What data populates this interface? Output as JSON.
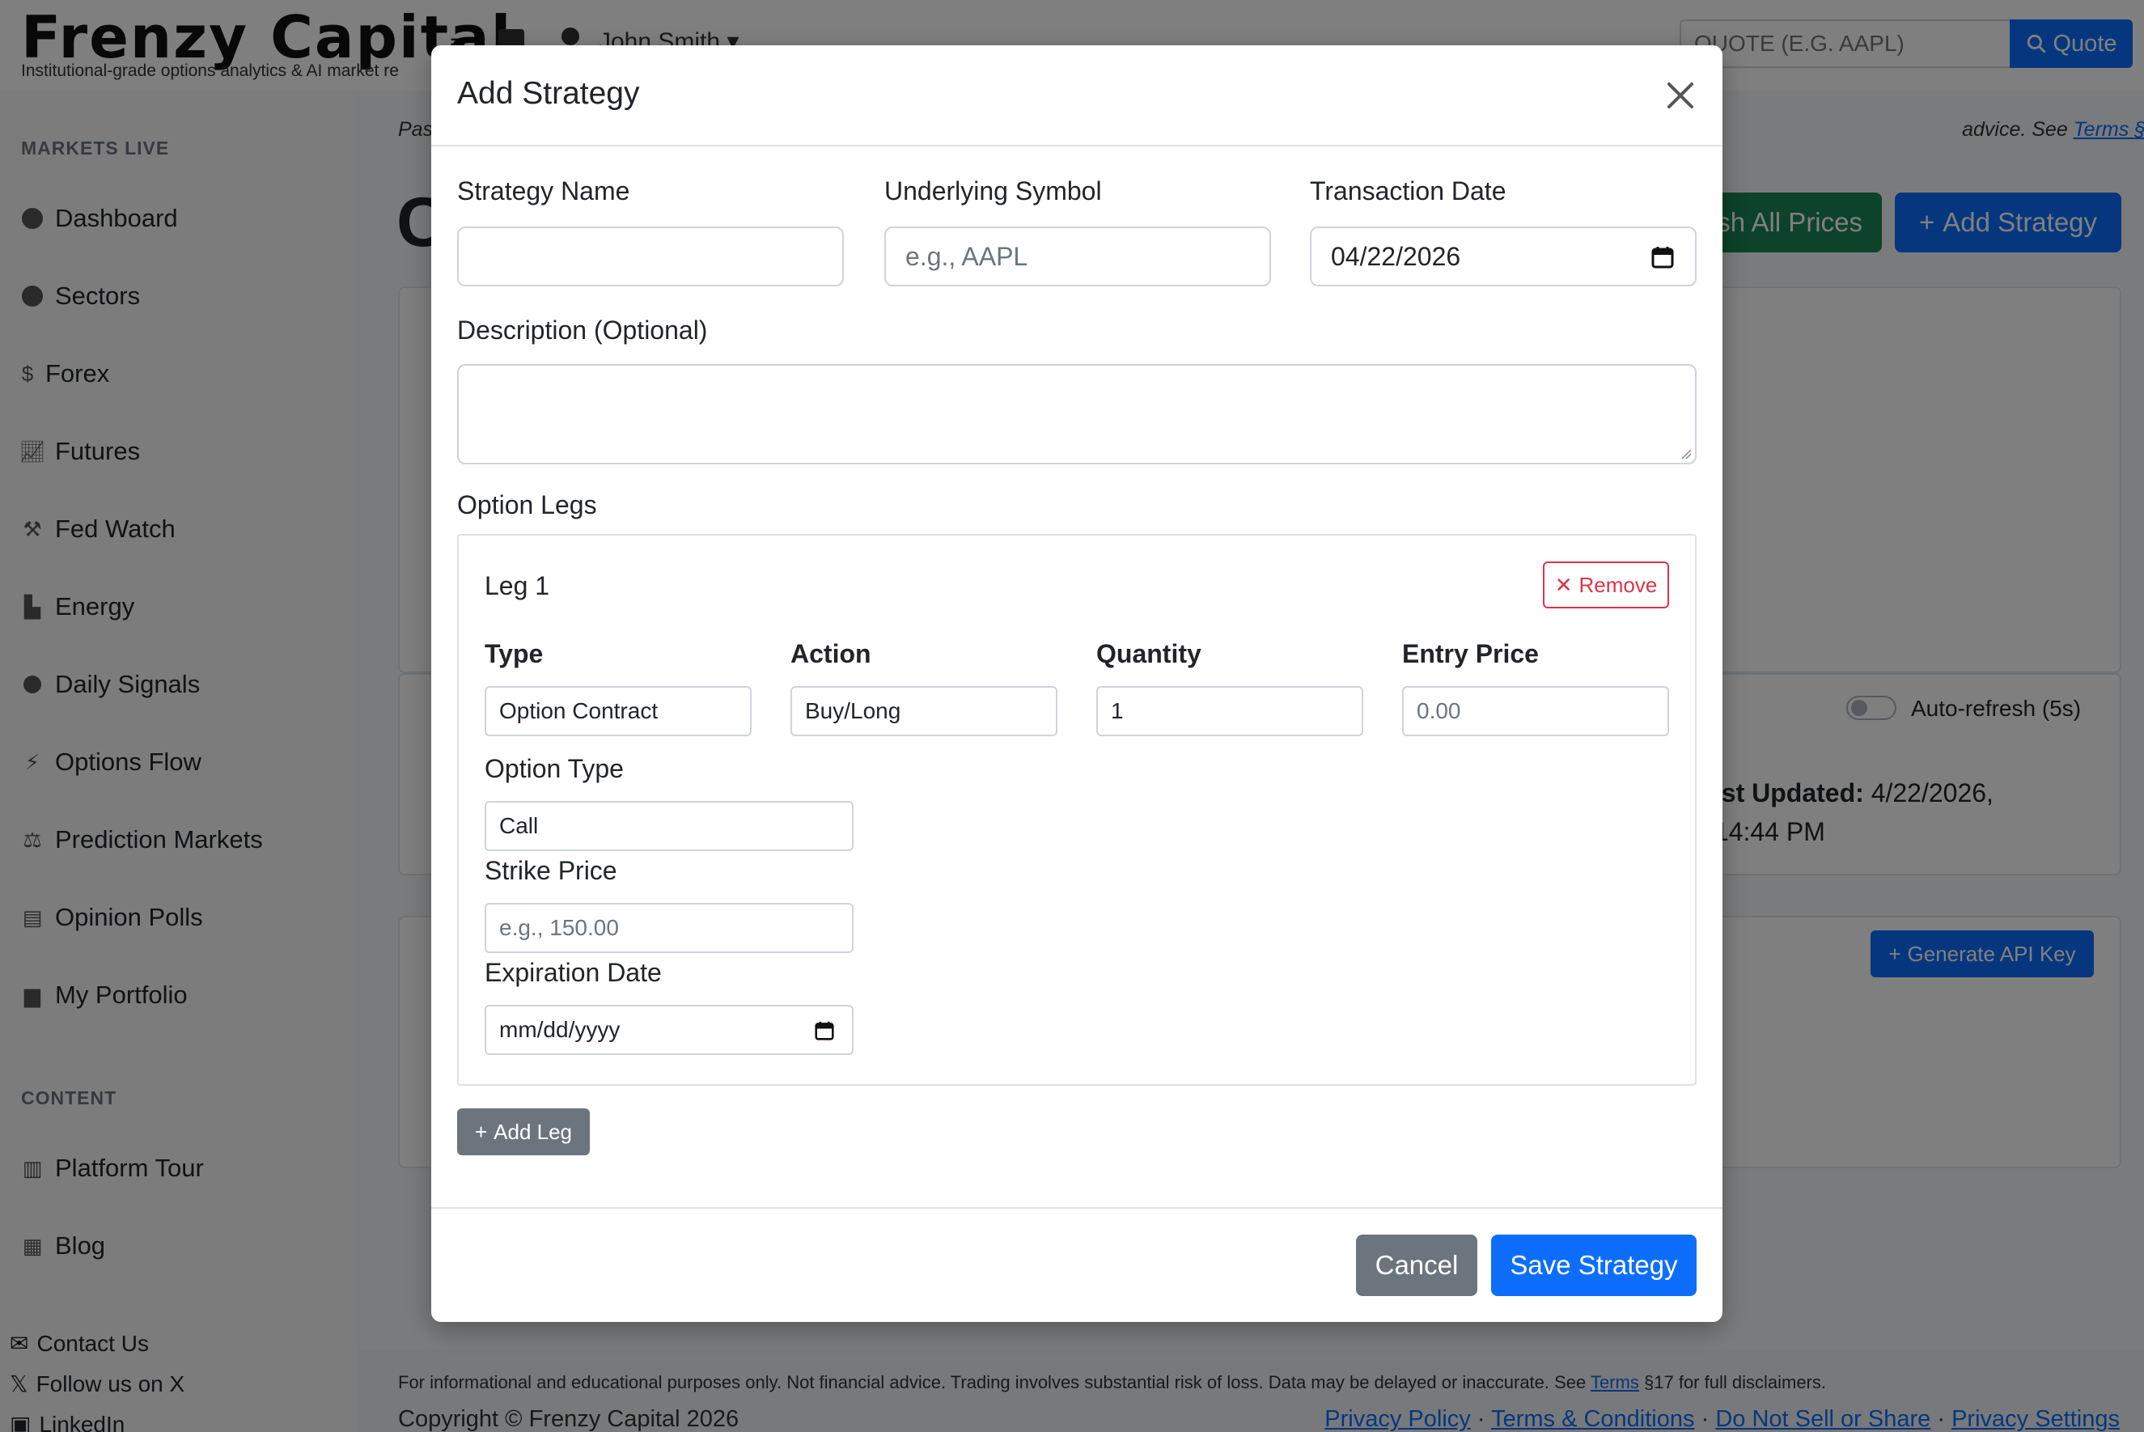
{
  "app": {
    "brand": "Frenzy Capital",
    "tagline": "Institutional-grade options analytics & AI market re",
    "user_name": "John Smith",
    "quote_placeholder": "QUOTE (E.G. AAPL)",
    "quote_button": "Quote"
  },
  "sidebar": {
    "sections": [
      {
        "title": "MARKETS LIVE"
      },
      {
        "title": "CONTENT"
      }
    ],
    "items": [
      {
        "label": "Dashboard"
      },
      {
        "label": "Sectors"
      },
      {
        "label": "Forex"
      },
      {
        "label": "Futures"
      },
      {
        "label": "Fed Watch"
      },
      {
        "label": "Energy"
      },
      {
        "label": "Daily Signals"
      },
      {
        "label": "Options Flow"
      },
      {
        "label": "Prediction Markets"
      },
      {
        "label": "Opinion Polls"
      },
      {
        "label": "My Portfolio"
      },
      {
        "label": "Platform Tour"
      },
      {
        "label": "Blog"
      }
    ],
    "footer_links": [
      {
        "label": "Contact Us"
      },
      {
        "label": "Follow us on X"
      },
      {
        "label": "LinkedIn"
      }
    ]
  },
  "main": {
    "notice_prefix": "Pas",
    "notice_suffix": "advice. See",
    "notice_link": "Terms §17",
    "heading_fragment": "C",
    "refresh_button": "sh All Prices",
    "add_strategy_button": "Add Strategy",
    "auto_refresh_label": "Auto-refresh (5s)",
    "last_updated_label": "ast Updated:",
    "last_updated_value": "4/22/2026,",
    "last_updated_time": ":14:44 PM",
    "generate_api_button": "Generate API Key"
  },
  "footer": {
    "disclaimer_text": "For informational and educational purposes only. Not financial advice. Trading involves substantial risk of loss. Data may be delayed or inaccurate. See",
    "disclaimer_link": "Terms",
    "disclaimer_end": "§17 for full disclaimers.",
    "copyright": "Copyright © Frenzy Capital 2026",
    "links": [
      "Privacy Policy",
      "Terms & Conditions",
      "Do Not Sell or Share",
      "Privacy Settings"
    ],
    "separator": "·"
  },
  "modal": {
    "title": "Add Strategy",
    "strategy_name_label": "Strategy Name",
    "strategy_name_value": "",
    "underlying_label": "Underlying Symbol",
    "underlying_placeholder": "e.g., AAPL",
    "transaction_date_label": "Transaction Date",
    "transaction_date_value": "04/22/2026",
    "description_label": "Description (Optional)",
    "description_value": "",
    "option_legs_label": "Option Legs",
    "leg": {
      "title": "Leg 1",
      "remove_button": "Remove",
      "type_label": "Type",
      "type_value": "Option Contract",
      "action_label": "Action",
      "action_value": "Buy/Long",
      "quantity_label": "Quantity",
      "quantity_value": "1",
      "entry_price_label": "Entry Price",
      "entry_price_placeholder": "0.00",
      "option_type_label": "Option Type",
      "option_type_value": "Call",
      "strike_price_label": "Strike Price",
      "strike_price_placeholder": "e.g., 150.00",
      "expiration_label": "Expiration Date",
      "expiration_placeholder": "mm/dd/yyyy"
    },
    "add_leg_button": "Add Leg",
    "cancel_button": "Cancel",
    "save_button": "Save Strategy"
  }
}
